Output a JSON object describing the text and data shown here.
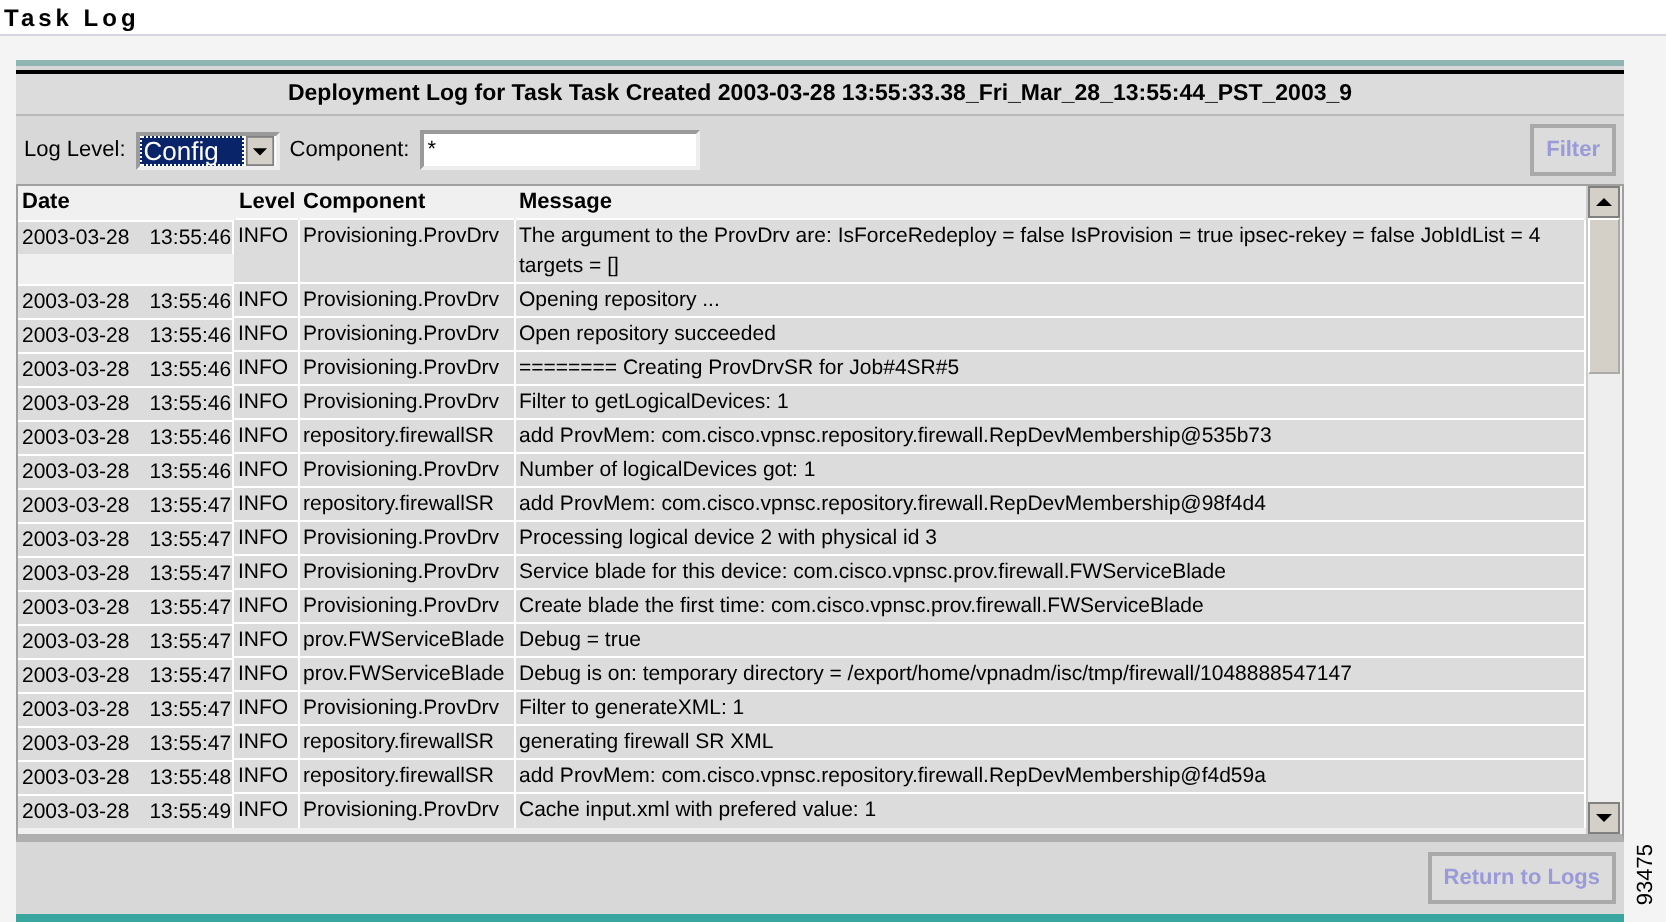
{
  "page_title": "Task Log",
  "panel": {
    "title": "Deployment Log for Task Task Created 2003-03-28 13:55:33.38_Fri_Mar_28_13:55:44_PST_2003_9",
    "log_level": {
      "label": "Log Level:",
      "value": "Config",
      "focused": true
    },
    "component": {
      "label": "Component:",
      "value": "*"
    },
    "filter_button": {
      "label": "Filter",
      "disabled": true
    },
    "table": {
      "columns": [
        "Date",
        "Level",
        "Component",
        "Message"
      ],
      "rows": [
        {
          "date": "2003-03-28",
          "time": "13:55:46",
          "level": "INFO",
          "component": "Provisioning.ProvDrv",
          "message": "The argument to the ProvDrv are: IsForceRedeploy = false IsProvision = true ipsec-rekey = false JobIdList = 4 targets = []"
        },
        {
          "date": "2003-03-28",
          "time": "13:55:46",
          "level": "INFO",
          "component": "Provisioning.ProvDrv",
          "message": "Opening repository ..."
        },
        {
          "date": "2003-03-28",
          "time": "13:55:46",
          "level": "INFO",
          "component": "Provisioning.ProvDrv",
          "message": "Open repository succeeded"
        },
        {
          "date": "2003-03-28",
          "time": "13:55:46",
          "level": "INFO",
          "component": "Provisioning.ProvDrv",
          "message": "======== Creating ProvDrvSR for Job#4SR#5"
        },
        {
          "date": "2003-03-28",
          "time": "13:55:46",
          "level": "INFO",
          "component": "Provisioning.ProvDrv",
          "message": "Filter to getLogicalDevices: 1"
        },
        {
          "date": "2003-03-28",
          "time": "13:55:46",
          "level": "INFO",
          "component": "repository.firewallSR",
          "message": "add ProvMem: com.cisco.vpnsc.repository.firewall.RepDevMembership@535b73"
        },
        {
          "date": "2003-03-28",
          "time": "13:55:46",
          "level": "INFO",
          "component": "Provisioning.ProvDrv",
          "message": "Number of logicalDevices got: 1"
        },
        {
          "date": "2003-03-28",
          "time": "13:55:47",
          "level": "INFO",
          "component": "repository.firewallSR",
          "message": "add ProvMem: com.cisco.vpnsc.repository.firewall.RepDevMembership@98f4d4"
        },
        {
          "date": "2003-03-28",
          "time": "13:55:47",
          "level": "INFO",
          "component": "Provisioning.ProvDrv",
          "message": "Processing logical device 2 with physical id 3"
        },
        {
          "date": "2003-03-28",
          "time": "13:55:47",
          "level": "INFO",
          "component": "Provisioning.ProvDrv",
          "message": "Service blade for this device: com.cisco.vpnsc.prov.firewall.FWServiceBlade"
        },
        {
          "date": "2003-03-28",
          "time": "13:55:47",
          "level": "INFO",
          "component": "Provisioning.ProvDrv",
          "message": "Create blade the first time: com.cisco.vpnsc.prov.firewall.FWServiceBlade"
        },
        {
          "date": "2003-03-28",
          "time": "13:55:47",
          "level": "INFO",
          "component": "prov.FWServiceBlade",
          "message": "Debug = true"
        },
        {
          "date": "2003-03-28",
          "time": "13:55:47",
          "level": "INFO",
          "component": "prov.FWServiceBlade",
          "message": "Debug is on: temporary directory = /export/home/vpnadm/isc/tmp/firewall/1048888547147"
        },
        {
          "date": "2003-03-28",
          "time": "13:55:47",
          "level": "INFO",
          "component": "Provisioning.ProvDrv",
          "message": "Filter to generateXML: 1"
        },
        {
          "date": "2003-03-28",
          "time": "13:55:47",
          "level": "INFO",
          "component": "repository.firewallSR",
          "message": "generating firewall SR XML"
        },
        {
          "date": "2003-03-28",
          "time": "13:55:48",
          "level": "INFO",
          "component": "repository.firewallSR",
          "message": "add ProvMem: com.cisco.vpnsc.repository.firewall.RepDevMembership@f4d59a"
        },
        {
          "date": "2003-03-28",
          "time": "13:55:49",
          "level": "INFO",
          "component": "Provisioning.ProvDrv",
          "message": "Cache input.xml with prefered value: 1"
        }
      ]
    },
    "return_button": {
      "label": "Return to Logs",
      "disabled": true
    }
  },
  "figure_id": "93475"
}
